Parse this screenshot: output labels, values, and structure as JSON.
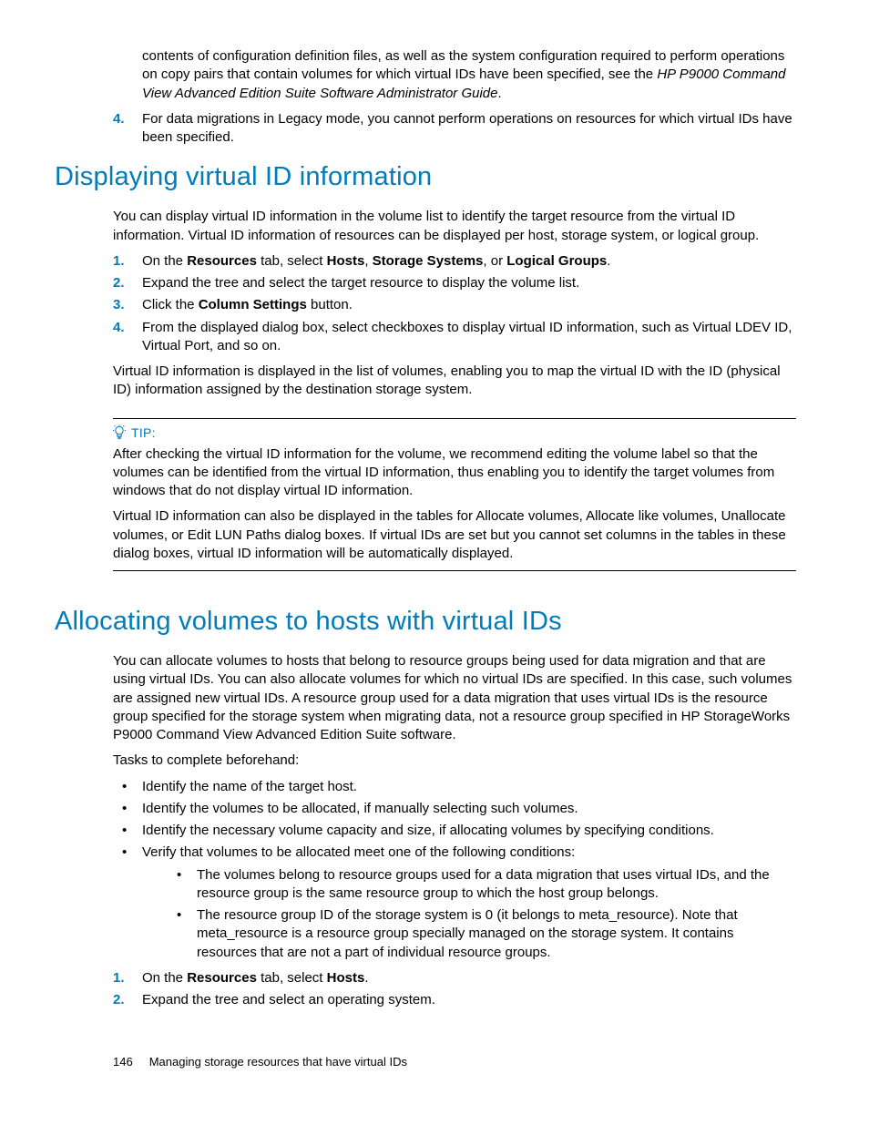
{
  "colors": {
    "accent": "#007cba"
  },
  "intro": {
    "continuation": "contents of configuration definition files, as well as the system configuration required to perform operations on copy pairs that contain volumes for which virtual IDs have been specified, see the ",
    "continuation_ref": "HP P9000 Command View Advanced Edition Suite Software Administrator Guide",
    "continuation_end": "."
  },
  "top_list": {
    "item4": "For data migrations in Legacy mode, you cannot perform operations on resources for which virtual IDs have been specified."
  },
  "section1": {
    "title": "Displaying virtual ID information",
    "intro": "You can display virtual ID information in the volume list to identify the target resource from the virtual ID information. Virtual ID information of resources can be displayed per host, storage system, or logical group.",
    "steps": {
      "s1_a": "On the ",
      "s1_b": "Resources",
      "s1_c": " tab, select ",
      "s1_d": "Hosts",
      "s1_e": ", ",
      "s1_f": "Storage Systems",
      "s1_g": ", or ",
      "s1_h": "Logical Groups",
      "s1_i": ".",
      "s2": "Expand the tree and select the target resource to display the volume list.",
      "s3_a": "Click the ",
      "s3_b": "Column Settings",
      "s3_c": " button.",
      "s4": "From the displayed dialog box, select checkboxes to display virtual ID information, such as Virtual LDEV ID, Virtual Port, and so on."
    },
    "after": "Virtual ID information is displayed in the list of volumes, enabling you to map the virtual ID with the ID (physical ID) information assigned by the destination storage system.",
    "tip": {
      "label": "TIP:",
      "p1": "After checking the virtual ID information for the volume, we recommend editing the volume label so that the volumes can be identified from the virtual ID information, thus enabling you to identify the target volumes from windows that do not display virtual ID information.",
      "p2": "Virtual ID information can also be displayed in the tables for Allocate volumes, Allocate like volumes, Unallocate volumes, or Edit LUN Paths dialog boxes. If virtual IDs are set but you cannot set columns in the tables in these dialog boxes, virtual ID information will be automatically displayed."
    }
  },
  "section2": {
    "title": "Allocating volumes to hosts with virtual IDs",
    "intro": "You can allocate volumes to hosts that belong to resource groups being used for data migration and that are using virtual IDs. You can also allocate volumes for which no virtual IDs are specified. In this case, such volumes are assigned new virtual IDs. A resource group used for a data migration that uses virtual IDs is the resource group specified for the storage system when migrating data, not a resource group specified in HP StorageWorks P9000 Command View Advanced Edition Suite software.",
    "tasks_label": "Tasks to complete beforehand:",
    "bullets": {
      "b1": "Identify the name of the target host.",
      "b2": "Identify the volumes to be allocated, if manually selecting such volumes.",
      "b3": "Identify the necessary volume capacity and size, if allocating volumes by specifying conditions.",
      "b4": "Verify that volumes to be allocated meet one of the following conditions:",
      "b4a": "The volumes belong to resource groups used for a data migration that uses virtual IDs, and the resource group is the same resource group to which the host group belongs.",
      "b4b": "The resource group ID of the storage system is 0 (it belongs to meta_resource). Note that meta_resource is a resource group specially managed on the storage system. It contains resources that are not a part of individual resource groups."
    },
    "steps": {
      "s1_a": "On the ",
      "s1_b": "Resources",
      "s1_c": " tab, select ",
      "s1_d": "Hosts",
      "s1_e": ".",
      "s2": "Expand the tree and select an operating system."
    }
  },
  "footer": {
    "page": "146",
    "chapter": "Managing storage resources that have virtual IDs"
  }
}
